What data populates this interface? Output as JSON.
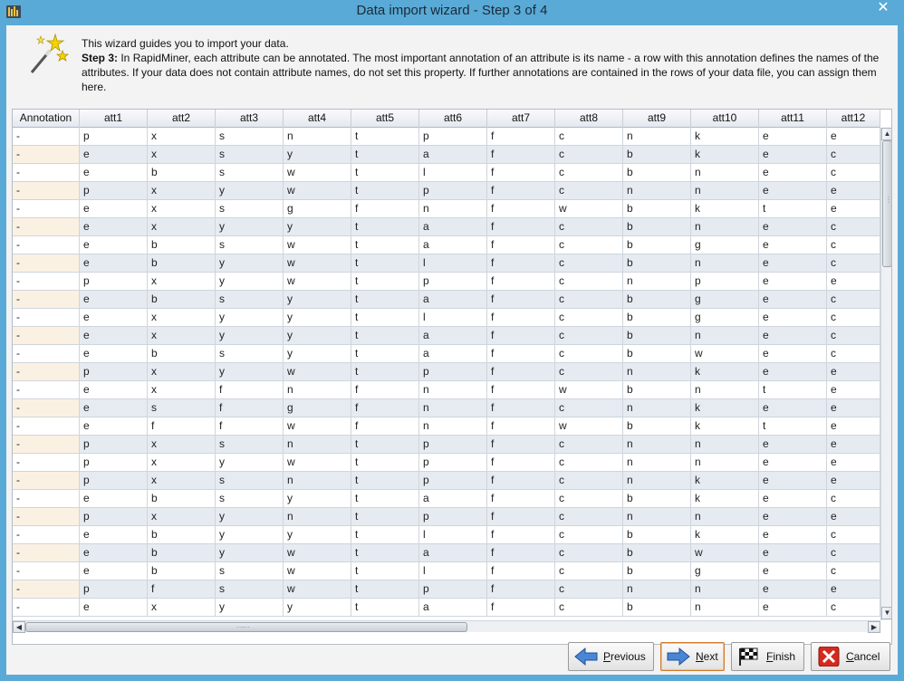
{
  "window": {
    "title": "Data import wizard - Step 3 of 4",
    "close_glyph": "✕"
  },
  "intro": {
    "line1": "This wizard guides you to import your data.",
    "step_label": "Step 3:",
    "step_text": " In RapidMiner, each attribute can be annotated. The most important annotation of an attribute is its name - a row with this annotation defines the names of the attributes. If your data does not contain attribute names, do not set this property. If further annotations are contained in the rows of your data file, you can assign them here."
  },
  "table": {
    "columns": [
      "Annotation",
      "att1",
      "att2",
      "att3",
      "att4",
      "att5",
      "att6",
      "att7",
      "att8",
      "att9",
      "att10",
      "att11",
      "att12"
    ],
    "rows": [
      [
        "-",
        "p",
        "x",
        "s",
        "n",
        "t",
        "p",
        "f",
        "c",
        "n",
        "k",
        "e",
        "e"
      ],
      [
        "-",
        "e",
        "x",
        "s",
        "y",
        "t",
        "a",
        "f",
        "c",
        "b",
        "k",
        "e",
        "c"
      ],
      [
        "-",
        "e",
        "b",
        "s",
        "w",
        "t",
        "l",
        "f",
        "c",
        "b",
        "n",
        "e",
        "c"
      ],
      [
        "-",
        "p",
        "x",
        "y",
        "w",
        "t",
        "p",
        "f",
        "c",
        "n",
        "n",
        "e",
        "e"
      ],
      [
        "-",
        "e",
        "x",
        "s",
        "g",
        "f",
        "n",
        "f",
        "w",
        "b",
        "k",
        "t",
        "e"
      ],
      [
        "-",
        "e",
        "x",
        "y",
        "y",
        "t",
        "a",
        "f",
        "c",
        "b",
        "n",
        "e",
        "c"
      ],
      [
        "-",
        "e",
        "b",
        "s",
        "w",
        "t",
        "a",
        "f",
        "c",
        "b",
        "g",
        "e",
        "c"
      ],
      [
        "-",
        "e",
        "b",
        "y",
        "w",
        "t",
        "l",
        "f",
        "c",
        "b",
        "n",
        "e",
        "c"
      ],
      [
        "-",
        "p",
        "x",
        "y",
        "w",
        "t",
        "p",
        "f",
        "c",
        "n",
        "p",
        "e",
        "e"
      ],
      [
        "-",
        "e",
        "b",
        "s",
        "y",
        "t",
        "a",
        "f",
        "c",
        "b",
        "g",
        "e",
        "c"
      ],
      [
        "-",
        "e",
        "x",
        "y",
        "y",
        "t",
        "l",
        "f",
        "c",
        "b",
        "g",
        "e",
        "c"
      ],
      [
        "-",
        "e",
        "x",
        "y",
        "y",
        "t",
        "a",
        "f",
        "c",
        "b",
        "n",
        "e",
        "c"
      ],
      [
        "-",
        "e",
        "b",
        "s",
        "y",
        "t",
        "a",
        "f",
        "c",
        "b",
        "w",
        "e",
        "c"
      ],
      [
        "-",
        "p",
        "x",
        "y",
        "w",
        "t",
        "p",
        "f",
        "c",
        "n",
        "k",
        "e",
        "e"
      ],
      [
        "-",
        "e",
        "x",
        "f",
        "n",
        "f",
        "n",
        "f",
        "w",
        "b",
        "n",
        "t",
        "e"
      ],
      [
        "-",
        "e",
        "s",
        "f",
        "g",
        "f",
        "n",
        "f",
        "c",
        "n",
        "k",
        "e",
        "e"
      ],
      [
        "-",
        "e",
        "f",
        "f",
        "w",
        "f",
        "n",
        "f",
        "w",
        "b",
        "k",
        "t",
        "e"
      ],
      [
        "-",
        "p",
        "x",
        "s",
        "n",
        "t",
        "p",
        "f",
        "c",
        "n",
        "n",
        "e",
        "e"
      ],
      [
        "-",
        "p",
        "x",
        "y",
        "w",
        "t",
        "p",
        "f",
        "c",
        "n",
        "n",
        "e",
        "e"
      ],
      [
        "-",
        "p",
        "x",
        "s",
        "n",
        "t",
        "p",
        "f",
        "c",
        "n",
        "k",
        "e",
        "e"
      ],
      [
        "-",
        "e",
        "b",
        "s",
        "y",
        "t",
        "a",
        "f",
        "c",
        "b",
        "k",
        "e",
        "c"
      ],
      [
        "-",
        "p",
        "x",
        "y",
        "n",
        "t",
        "p",
        "f",
        "c",
        "n",
        "n",
        "e",
        "e"
      ],
      [
        "-",
        "e",
        "b",
        "y",
        "y",
        "t",
        "l",
        "f",
        "c",
        "b",
        "k",
        "e",
        "c"
      ],
      [
        "-",
        "e",
        "b",
        "y",
        "w",
        "t",
        "a",
        "f",
        "c",
        "b",
        "w",
        "e",
        "c"
      ],
      [
        "-",
        "e",
        "b",
        "s",
        "w",
        "t",
        "l",
        "f",
        "c",
        "b",
        "g",
        "e",
        "c"
      ],
      [
        "-",
        "p",
        "f",
        "s",
        "w",
        "t",
        "p",
        "f",
        "c",
        "n",
        "n",
        "e",
        "e"
      ],
      [
        "-",
        "e",
        "x",
        "y",
        "y",
        "t",
        "a",
        "f",
        "c",
        "b",
        "n",
        "e",
        "c"
      ]
    ]
  },
  "buttons": {
    "previous": {
      "pre": "",
      "mnemonic": "P",
      "post": "revious"
    },
    "next": {
      "pre": "",
      "mnemonic": "N",
      "post": "ext"
    },
    "finish": {
      "pre": "",
      "mnemonic": "F",
      "post": "inish"
    },
    "cancel": {
      "pre": "",
      "mnemonic": "C",
      "post": "ancel"
    }
  },
  "icons": {
    "app": "rapidminer-app-icon",
    "wizard": "magic-wand-icon",
    "previous": "arrow-left-icon",
    "next": "arrow-right-icon",
    "finish": "checkered-flag-icon",
    "cancel": "red-x-icon"
  },
  "colors": {
    "titlebar": "#59aad6",
    "row_alt": "#e6ebf2",
    "annotation_alt": "#fbf1e3",
    "focus_border": "#d07a2a"
  }
}
